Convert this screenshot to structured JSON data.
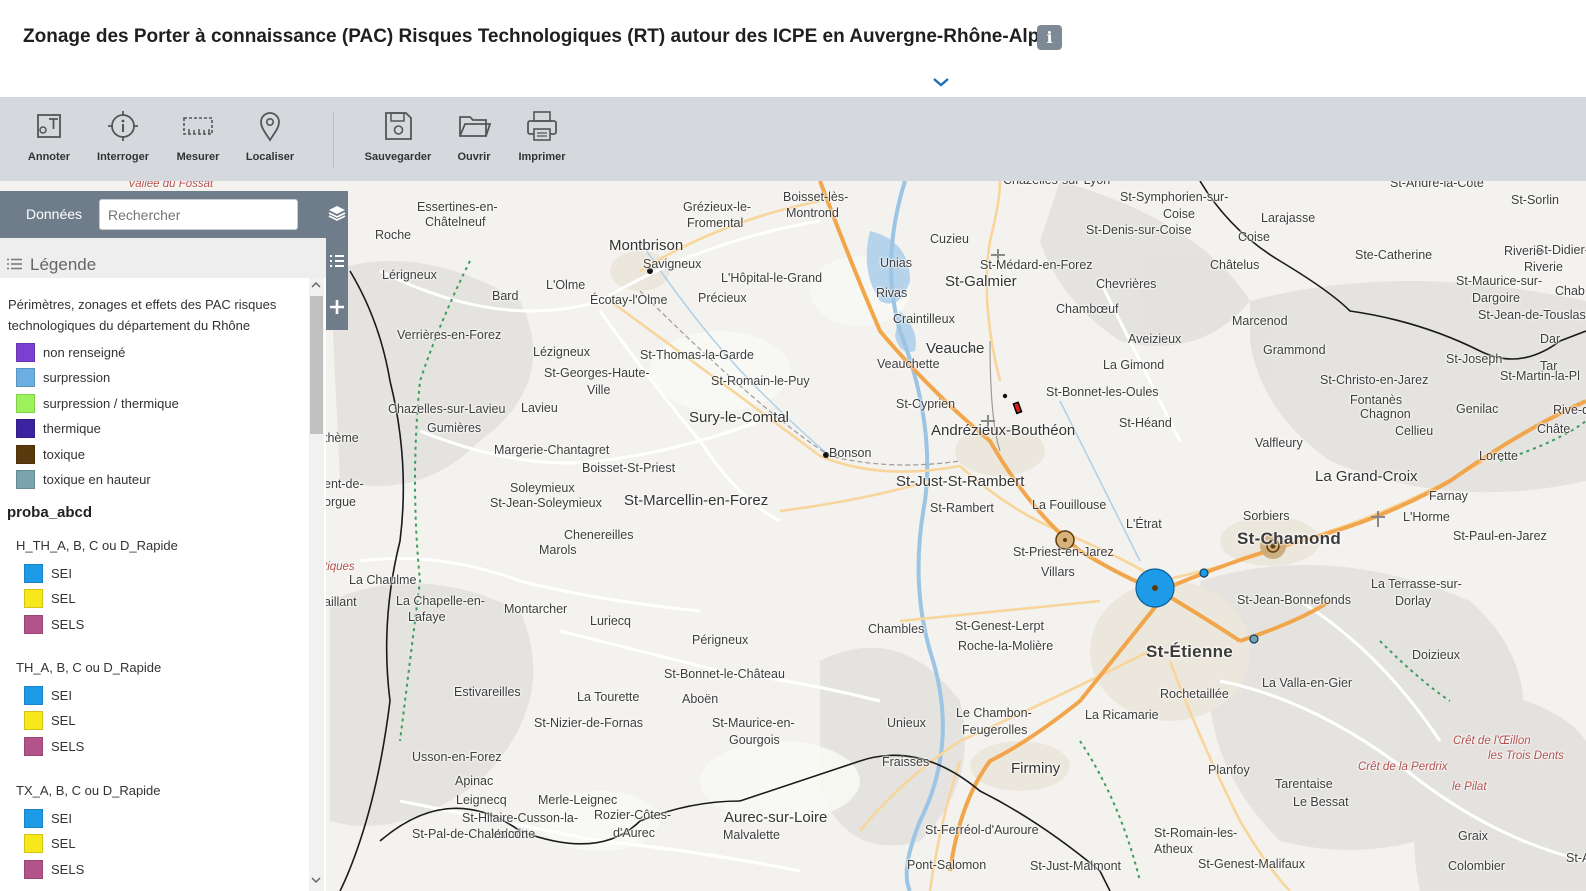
{
  "header": {
    "title": "Zonage des Porter à connaissance (PAC) Risques Technologiques (RT) autour des ICPE en Auvergne-Rhône-Alpes",
    "info_icon": "info-icon",
    "collapse_icon": "chevron-down-icon"
  },
  "toolbar": {
    "annoter": "Annoter",
    "interroger": "Interroger",
    "mesurer": "Mesurer",
    "localiser": "Localiser",
    "sauvegarder": "Sauvegarder",
    "ouvrir": "Ouvrir",
    "imprimer": "Imprimer"
  },
  "panel": {
    "tab_label": "Données",
    "search_placeholder": "Rechercher",
    "legend_title": "Légende",
    "legend_desc": "Périmètres, zonages et effets des PAC risques technologiques du département du Rhône",
    "categories": [
      {
        "label": "non renseigné",
        "color": "#7b3fd1"
      },
      {
        "label": "surpression",
        "color": "#6aaee2"
      },
      {
        "label": "surpression / thermique",
        "color": "#9cf25a"
      },
      {
        "label": "thermique",
        "color": "#3b22a0"
      },
      {
        "label": "toxique",
        "color": "#5a3a0c"
      },
      {
        "label": "toxique en hauteur",
        "color": "#7aa3ad"
      }
    ],
    "group_title": "proba_abcd",
    "subgroups": [
      {
        "title": "H_TH_A, B, C ou D_Rapide",
        "items": [
          "SEI",
          "SEL",
          "SELS"
        ]
      },
      {
        "title": "TH_A, B, C ou D_Rapide",
        "items": [
          "SEI",
          "SEL",
          "SELS"
        ]
      },
      {
        "title": "TX_A, B, C ou D_Rapide",
        "items": [
          "SEI",
          "SEL",
          "SELS"
        ]
      }
    ],
    "sub_colors": {
      "SEI": "#1e9be8",
      "SEL": "#f7e81c",
      "SELS": "#b3538a"
    }
  },
  "map": {
    "places": [
      {
        "name": "Vallée du Fossat",
        "cls": "ital"
      },
      {
        "name": "Boisset-lès-"
      },
      {
        "name": "Montrond"
      },
      {
        "name": "Grézieux-le-"
      },
      {
        "name": "Fromental"
      },
      {
        "name": "Essertines-en-"
      },
      {
        "name": "Châtelneuf"
      },
      {
        "name": "Roche"
      },
      {
        "name": "Montbrison",
        "cls": "big"
      },
      {
        "name": "Savigneux"
      },
      {
        "name": "L'Hôpital-le-Grand"
      },
      {
        "name": "Cuzieu"
      },
      {
        "name": "Unias"
      },
      {
        "name": "Rivas"
      },
      {
        "name": "Craintilleux"
      },
      {
        "name": "St-Galmier",
        "cls": "big"
      },
      {
        "name": "St-Médard-en-Forez"
      },
      {
        "name": "Chevrières"
      },
      {
        "name": "Chambœuf"
      },
      {
        "name": "St-Symphorien-sur-"
      },
      {
        "name": "Coise"
      },
      {
        "name": "St-Denis-sur-Coise"
      },
      {
        "name": "Larajasse"
      },
      {
        "name": "Coise"
      },
      {
        "name": "Châtelus"
      },
      {
        "name": "St-Sorlin"
      },
      {
        "name": "St-Didier-sur-"
      },
      {
        "name": "Riverie"
      },
      {
        "name": "Ste-Catherine"
      },
      {
        "name": "Riverie"
      },
      {
        "name": "St-Maurice-sur-"
      },
      {
        "name": "Dargoire"
      },
      {
        "name": "St-Jean-de-Touslas"
      },
      {
        "name": "Chab"
      },
      {
        "name": "Lérigneux"
      },
      {
        "name": "Bard"
      },
      {
        "name": "L'Olme"
      },
      {
        "name": "Écotay-l'Olme"
      },
      {
        "name": "Précieux"
      },
      {
        "name": "Verrières-en-Forez"
      },
      {
        "name": "Lézigneux"
      },
      {
        "name": "St-Thomas-la-Garde"
      },
      {
        "name": "St-Georges-Haute-"
      },
      {
        "name": "Ville"
      },
      {
        "name": "St-Romain-le-Puy"
      },
      {
        "name": "Veauche",
        "cls": "big"
      },
      {
        "name": "Veauchette"
      },
      {
        "name": "Aveizieux"
      },
      {
        "name": "La Gimond"
      },
      {
        "name": "Marcenod"
      },
      {
        "name": "Grammond"
      },
      {
        "name": "St-Joseph"
      },
      {
        "name": "St-Martin-la-Pl"
      },
      {
        "name": "St-Christo-en-Jarez"
      },
      {
        "name": "Fontanès"
      },
      {
        "name": "Chazelles-sur-Lavieu"
      },
      {
        "name": "Lavieu"
      },
      {
        "name": "Gumières"
      },
      {
        "name": "Sury-le-Comtal",
        "cls": "big"
      },
      {
        "name": "St-Cyprien"
      },
      {
        "name": "St-Bonnet-les-Oules"
      },
      {
        "name": "Andrézieux-Bouthéon",
        "cls": "big"
      },
      {
        "name": "St-Héand"
      },
      {
        "name": "Chagnon"
      },
      {
        "name": "Genilac"
      },
      {
        "name": "Rive-de"
      },
      {
        "name": "Cellieu"
      },
      {
        "name": "Châte"
      },
      {
        "name": "Valfleury"
      },
      {
        "name": "Lorette"
      },
      {
        "name": "Margerie-Chantagret"
      },
      {
        "name": "Bonson"
      },
      {
        "name": "Boisset-St-Priest"
      },
      {
        "name": "St-Just-St-Rambert",
        "cls": "big"
      },
      {
        "name": "La Grand-Croix",
        "cls": "big"
      },
      {
        "name": "Farnay"
      },
      {
        "name": "Soleymieux"
      },
      {
        "name": "St-Jean-Soleymieux"
      },
      {
        "name": "St-Marcellin-en-Forez",
        "cls": "big"
      },
      {
        "name": "St-Rambert"
      },
      {
        "name": "La Fouillouse"
      },
      {
        "name": "L'Étrat"
      },
      {
        "name": "Sorbiers"
      },
      {
        "name": "St-Chamond",
        "cls": "city"
      },
      {
        "name": "L'Horme"
      },
      {
        "name": "St-Paul-en-Jarez"
      },
      {
        "name": "Chenereilles"
      },
      {
        "name": "Marols"
      },
      {
        "name": "St-Priest-en-Jarez"
      },
      {
        "name": "Villars"
      },
      {
        "name": "La Terrasse-sur-"
      },
      {
        "name": "Dorlay"
      },
      {
        "name": "La Chaulme"
      },
      {
        "name": "La Chapelle-en-"
      },
      {
        "name": "Lafaye"
      },
      {
        "name": "Montarcher"
      },
      {
        "name": "Luriecq"
      },
      {
        "name": "St-Jean-Bonnefonds"
      },
      {
        "name": "Chambles"
      },
      {
        "name": "St-Genest-Lerpt"
      },
      {
        "name": "Roche-la-Molière"
      },
      {
        "name": "St-Étienne",
        "cls": "city"
      },
      {
        "name": "Doizieux"
      },
      {
        "name": "Périgneux"
      },
      {
        "name": "Estivareilles"
      },
      {
        "name": "La Tourette"
      },
      {
        "name": "St-Bonnet-le-Château"
      },
      {
        "name": "Aboën"
      },
      {
        "name": "Rochetaillée"
      },
      {
        "name": "La Valla-en-Gier"
      },
      {
        "name": "St-Nizier-de-Fornas"
      },
      {
        "name": "St-Maurice-en-"
      },
      {
        "name": "Gourgois"
      },
      {
        "name": "Unieux"
      },
      {
        "name": "Le Chambon-"
      },
      {
        "name": "Feugerolles"
      },
      {
        "name": "La Ricamarie"
      },
      {
        "name": "Usson-en-Forez"
      },
      {
        "name": "Apinac"
      },
      {
        "name": "Fraisses"
      },
      {
        "name": "Firminy",
        "cls": "big"
      },
      {
        "name": "Planfoy"
      },
      {
        "name": "Crêt de l'Œillon",
        "cls": "ital"
      },
      {
        "name": "les Trois Dents",
        "cls": "ital"
      },
      {
        "name": "Crêt de la Perdrix",
        "cls": "ital"
      },
      {
        "name": "le Pilat",
        "cls": "ital"
      },
      {
        "name": "Tarentaise"
      },
      {
        "name": "Le Bessat"
      },
      {
        "name": "Leignecq"
      },
      {
        "name": "Merle-Leignec"
      },
      {
        "name": "Rozier-Côtes-"
      },
      {
        "name": "d'Aurec"
      },
      {
        "name": "Aurec-sur-Loire",
        "cls": "big"
      },
      {
        "name": "Malvalette"
      },
      {
        "name": "St-Hilaire-Cusson-la-"
      },
      {
        "name": "Valmitte"
      },
      {
        "name": "St-Pal-de-Chalencon"
      },
      {
        "name": "St-Ferréol-d'Auroure"
      },
      {
        "name": "St-Romain-les-"
      },
      {
        "name": "Atheux"
      },
      {
        "name": "Graix"
      },
      {
        "name": "St-Appolinard"
      },
      {
        "name": "Colombier"
      },
      {
        "name": "Pont-Salomon"
      },
      {
        "name": "St-Just-Malmont"
      },
      {
        "name": "St-Genest-Malifaux"
      },
      {
        "name": "St-André-la-Côte"
      },
      {
        "name": "Chazelles-sur-Lyon"
      },
      {
        "name": "thème"
      },
      {
        "name": "ent-de-"
      },
      {
        "name": "orgue"
      },
      {
        "name": "tiques",
        "cls": "ital"
      },
      {
        "name": "aillant"
      },
      {
        "name": "Dar"
      },
      {
        "name": "Tar"
      }
    ]
  }
}
